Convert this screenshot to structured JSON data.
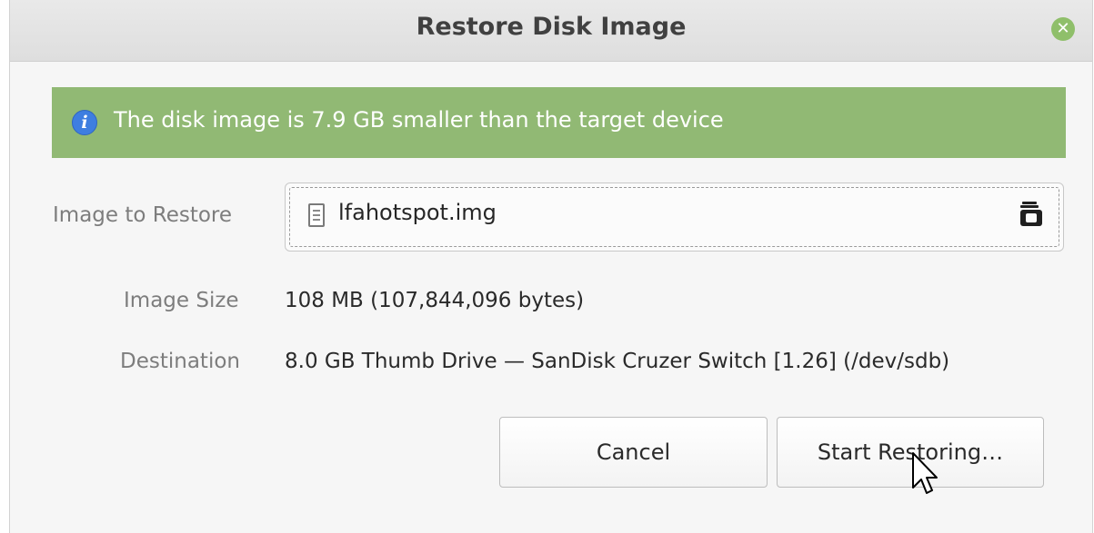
{
  "window": {
    "title": "Restore Disk Image",
    "close_icon": "close-icon"
  },
  "infobar": {
    "icon": "info-icon",
    "icon_glyph": "i",
    "message": "The disk image is 7.9 GB smaller than the target device",
    "background_color": "#91b974"
  },
  "form": {
    "image_label": "Image to Restore",
    "image_file": "lfahotspot.img",
    "size_label": "Image Size",
    "size_value": "108 MB (107,844,096 bytes)",
    "destination_label": "Destination",
    "destination_value": "8.0 GB Thumb Drive — SanDisk Cruzer Switch [1.26] (/dev/sdb)"
  },
  "buttons": {
    "cancel_label": "Cancel",
    "start_label": "Start Restoring…"
  }
}
